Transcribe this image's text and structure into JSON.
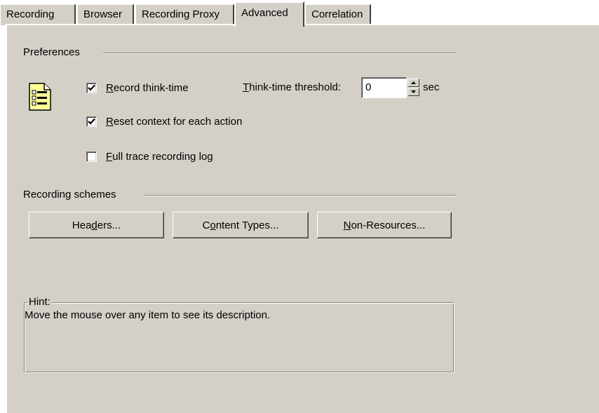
{
  "tabs": [
    {
      "label": "Recording",
      "active": false
    },
    {
      "label": "Browser",
      "active": false
    },
    {
      "label": "Recording Proxy",
      "active": false
    },
    {
      "label": "Advanced",
      "active": true
    },
    {
      "label": "Correlation",
      "active": false
    }
  ],
  "preferences": {
    "title": "Preferences",
    "icon": "document-list-icon",
    "record_think_time": {
      "pre": "",
      "mn": "R",
      "post": "ecord think-time",
      "checked": true
    },
    "reset_context": {
      "pre": "",
      "mn": "R",
      "post": "eset context for each action",
      "checked": true
    },
    "full_trace": {
      "pre": "",
      "mn": "F",
      "post": "ull trace recording log",
      "checked": false
    },
    "threshold": {
      "pre": "",
      "mn": "T",
      "post": "hink-time threshold:",
      "value": "0",
      "unit": "sec"
    }
  },
  "schemes": {
    "title": "Recording schemes",
    "headers": {
      "pre": "Hea",
      "mn": "d",
      "post": "ers..."
    },
    "content_types": {
      "pre": "C",
      "mn": "o",
      "post": "ntent Types..."
    },
    "non_resources": {
      "pre": "",
      "mn": "N",
      "post": "on-Resources..."
    }
  },
  "hint": {
    "title": "Hint:",
    "text": "Move the mouse over any item to see its description."
  },
  "colors": {
    "face": "#d4d0c8",
    "shadow": "#808080",
    "highlight": "#ffffff",
    "icon_fill": "#ffff99"
  }
}
